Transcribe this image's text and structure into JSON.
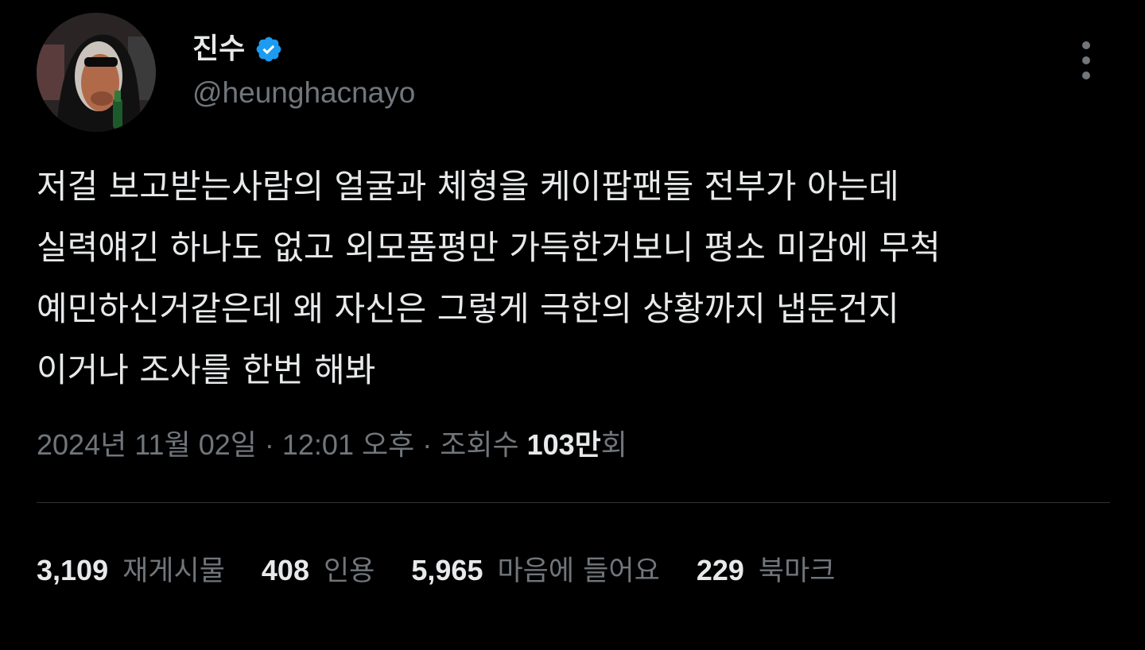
{
  "author": {
    "display_name": "진수",
    "handle": "@heunghacnayo",
    "verified": true,
    "verified_icon": "verified-badge-icon",
    "verified_color": "#1d9bf0",
    "avatar_icon": "avatar-image"
  },
  "menu": {
    "icon": "more-vertical-icon"
  },
  "tweet": {
    "lines": [
      "저걸 보고받는사람의 얼굴과 체형을 케이팝팬들 전부가 아는데",
      "실력얘긴 하나도 없고 외모품평만 가득한거보니 평소 미감에 무척",
      "예민하신거같은데 왜 자신은 그렇게 극한의 상황까지 냅둔건지",
      "이거나 조사를 한번 해봐"
    ]
  },
  "meta": {
    "date": "2024년 11월 02일",
    "separator": "·",
    "time": "12:01 오후",
    "views_label": "조회수",
    "views_count": "103만",
    "views_suffix": "회"
  },
  "stats": [
    {
      "count": "3,109",
      "label": "재게시물"
    },
    {
      "count": "408",
      "label": "인용"
    },
    {
      "count": "5,965",
      "label": "마음에 들어요"
    },
    {
      "count": "229",
      "label": "북마크"
    }
  ],
  "colors": {
    "background": "#000000",
    "primary_text": "#e7e9ea",
    "secondary_text": "#71767b",
    "divider": "#2f3336",
    "accent": "#1d9bf0"
  }
}
